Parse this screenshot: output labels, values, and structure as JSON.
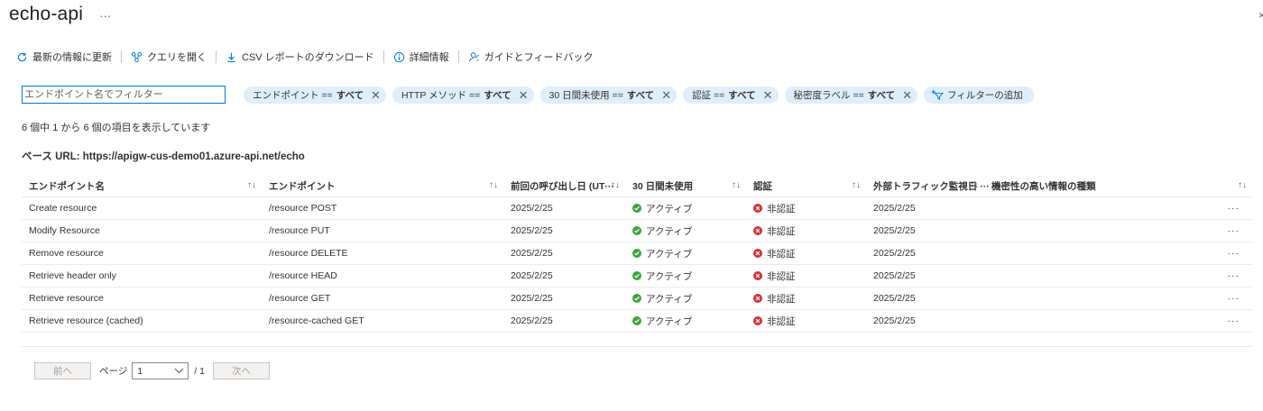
{
  "header": {
    "title": "echo-api",
    "more": "···",
    "close": "×"
  },
  "toolbar": {
    "refresh": "最新の情報に更新",
    "open_query": "クエリを開く",
    "download_csv": "CSV レポートのダウンロード",
    "details": "詳細情報",
    "guide_feedback": "ガイドとフィードバック"
  },
  "filter": {
    "placeholder": "エンドポイント名でフィルター",
    "pills": [
      {
        "label": "エンドポイント ==",
        "value": "すべて"
      },
      {
        "label": "HTTP メソッド ==",
        "value": "すべて"
      },
      {
        "label": "30 日間未使用 ==",
        "value": "すべて"
      },
      {
        "label": "認証 ==",
        "value": "すべて"
      },
      {
        "label": "秘密度ラベル ==",
        "value": "すべて"
      }
    ],
    "add_filter": "フィルターの追加",
    "remove_glyph": "✕"
  },
  "summary": "6 個中 1 から 6 個の項目を表示しています",
  "base_url": "ベース URL: https://apigw-cus-demo01.azure-api.net/echo",
  "table": {
    "headers": [
      "エンドポイント名",
      "エンドポイント",
      "前回の呼び出し日 (UT···",
      "30 日間未使用",
      "認証",
      "外部トラフィック監視日 ···",
      "機密性の高い情報の種類"
    ],
    "sort_glyph": "↑↓",
    "rows": [
      {
        "name": "Create resource",
        "endpoint": "/resource POST",
        "last_called": "2025/2/25",
        "unused": "アクティブ",
        "auth": "非認証",
        "monitored": "2025/2/25",
        "sensitive": ""
      },
      {
        "name": "Modify Resource",
        "endpoint": "/resource PUT",
        "last_called": "2025/2/25",
        "unused": "アクティブ",
        "auth": "非認証",
        "monitored": "2025/2/25",
        "sensitive": ""
      },
      {
        "name": "Remove resource",
        "endpoint": "/resource DELETE",
        "last_called": "2025/2/25",
        "unused": "アクティブ",
        "auth": "非認証",
        "monitored": "2025/2/25",
        "sensitive": ""
      },
      {
        "name": "Retrieve header only",
        "endpoint": "/resource HEAD",
        "last_called": "2025/2/25",
        "unused": "アクティブ",
        "auth": "非認証",
        "monitored": "2025/2/25",
        "sensitive": ""
      },
      {
        "name": "Retrieve resource",
        "endpoint": "/resource GET",
        "last_called": "2025/2/25",
        "unused": "アクティブ",
        "auth": "非認証",
        "monitored": "2025/2/25",
        "sensitive": ""
      },
      {
        "name": "Retrieve resource (cached)",
        "endpoint": "/resource-cached GET",
        "last_called": "2025/2/25",
        "unused": "アクティブ",
        "auth": "非認証",
        "monitored": "2025/2/25",
        "sensitive": ""
      }
    ],
    "row_more": "···"
  },
  "pager": {
    "prev": "前へ",
    "page_label": "ページ",
    "current": "1",
    "total": "/ 1",
    "next": "次へ"
  },
  "colors": {
    "accent": "#0078d4",
    "pill_bg": "#dfeefa",
    "success": "#3fa33f",
    "error": "#d13438"
  }
}
